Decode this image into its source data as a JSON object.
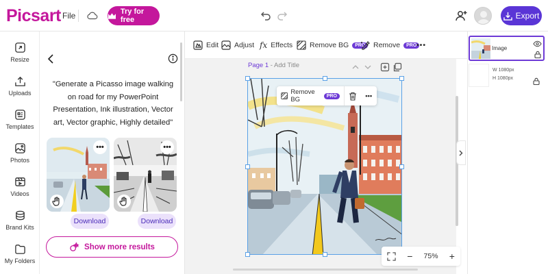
{
  "topbar": {
    "logo": "Picsart",
    "file_label": "File",
    "try_label": "Try for free",
    "export_label": "Export"
  },
  "rail": {
    "items": [
      {
        "label": "Resize",
        "icon": "resize-icon"
      },
      {
        "label": "Uploads",
        "icon": "upload-icon"
      },
      {
        "label": "Templates",
        "icon": "templates-icon"
      },
      {
        "label": "Photos",
        "icon": "photos-icon"
      },
      {
        "label": "Videos",
        "icon": "videos-icon"
      },
      {
        "label": "Brand Kits",
        "icon": "brand-kit-icon"
      },
      {
        "label": "My Folders",
        "icon": "folder-icon"
      }
    ]
  },
  "panel": {
    "prompt": "\"Generate a Picasso image walking on road for my PowerPoint Presentation, Ink illustration, Vector art, Vector graphic, Highly detailed\"",
    "results": [
      {
        "download_label": "Download",
        "menu": "•••"
      },
      {
        "download_label": "Download",
        "menu": "•••"
      }
    ],
    "more_label": "Show more results"
  },
  "toolbar": {
    "edit": "Edit",
    "adjust": "Adjust",
    "effects": "Effects",
    "remove_bg": "Remove BG",
    "remove": "Remove",
    "pro_badge": "PRO",
    "more": "•••"
  },
  "canvas": {
    "page_label": "Page 1",
    "page_sep": " - ",
    "add_title": "Add Title",
    "float_remove_bg": "Remove BG",
    "float_pro": "PRO",
    "float_more": "•••",
    "zoom": "75%"
  },
  "layers": {
    "layer1_label": "Image",
    "w_label": "W",
    "w_value": "1080px",
    "h_label": "H",
    "h_value": "1080px"
  },
  "colors": {
    "brand": "#c4179c",
    "accent": "#5a35d6",
    "pro": "#6d3ad6",
    "selection": "#5aa0e6"
  }
}
